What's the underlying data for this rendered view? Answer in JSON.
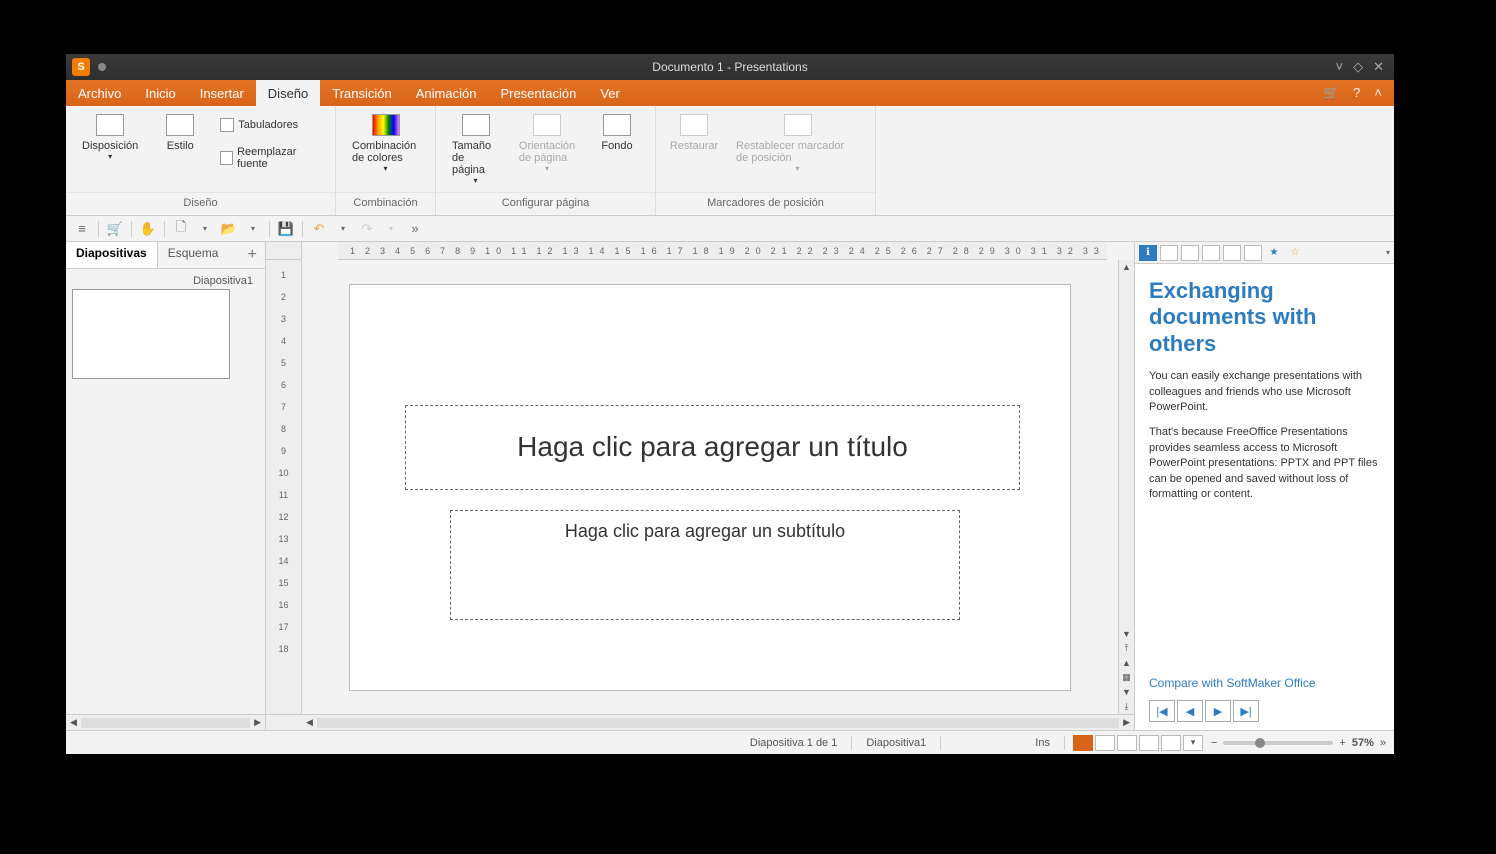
{
  "titlebar": {
    "title": "Documento 1 - Presentations",
    "app_letter": "S"
  },
  "menu": {
    "tabs": [
      "Archivo",
      "Inicio",
      "Insertar",
      "Diseño",
      "Transición",
      "Animación",
      "Presentación",
      "Ver"
    ],
    "active_index": 3
  },
  "ribbon": {
    "groups": [
      {
        "label": "Diseño",
        "items": [
          {
            "kind": "big",
            "label": "Disposición",
            "drop": true
          },
          {
            "kind": "big",
            "label": "Estilo"
          },
          {
            "kind": "small",
            "label": "Tabuladores"
          },
          {
            "kind": "small",
            "label": "Reemplazar fuente"
          }
        ]
      },
      {
        "label": "Combinación",
        "items": [
          {
            "kind": "big",
            "label": "Combinación de colores",
            "drop": true,
            "color": true
          }
        ]
      },
      {
        "label": "Configurar página",
        "items": [
          {
            "kind": "big",
            "label": "Tamaño de página",
            "drop": true
          },
          {
            "kind": "big",
            "label": "Orientación de página",
            "drop": true,
            "disabled": true
          },
          {
            "kind": "big",
            "label": "Fondo"
          }
        ]
      },
      {
        "label": "Marcadores de posición",
        "items": [
          {
            "kind": "big",
            "label": "Restaurar",
            "disabled": true
          },
          {
            "kind": "big",
            "label": "Restablecer marcador de posición",
            "drop": true,
            "disabled": true
          }
        ]
      }
    ]
  },
  "quickbar": {
    "hamburger": "≡",
    "cart": "🛒",
    "hand": "✋",
    "new": "🗋",
    "open": "📂",
    "save": "💾",
    "undo": "↶",
    "redo": "↷",
    "more": "»"
  },
  "sidebar": {
    "tabs": [
      "Diapositivas",
      "Esquema"
    ],
    "active": 0,
    "thumb_label": "Diapositiva1"
  },
  "ruler_h": [
    "1",
    "2",
    "3",
    "4",
    "5",
    "6",
    "7",
    "8",
    "9",
    "10",
    "11",
    "12",
    "13",
    "14",
    "15",
    "16",
    "17",
    "18",
    "19",
    "20",
    "21",
    "22",
    "23",
    "24",
    "25",
    "26",
    "27",
    "28",
    "29",
    "30",
    "31",
    "32",
    "33"
  ],
  "ruler_v": [
    "1",
    "2",
    "3",
    "4",
    "5",
    "6",
    "7",
    "8",
    "9",
    "10",
    "11",
    "12",
    "13",
    "14",
    "15",
    "16",
    "17",
    "18"
  ],
  "slide": {
    "title_placeholder": "Haga clic para agregar un título",
    "subtitle_placeholder": "Haga clic para agregar un subtítulo"
  },
  "rightpane": {
    "heading": "Exchanging documents with others",
    "p1": "You can easily exchange presentations with colleagues and friends who use Microsoft PowerPoint.",
    "p2": "That's because FreeOffice Presentations provides seamless access to Microsoft PowerPoint presentations: PPTX and PPT files can be opened and saved without loss of formatting or content.",
    "link": "Compare with SoftMaker Office",
    "info_glyph": "ℹ",
    "star1": "★",
    "star2": "☆",
    "nav": {
      "first": "|◀",
      "prev": "◀",
      "next": "▶",
      "last": "▶|"
    }
  },
  "status": {
    "slide_info": "Diapositiva 1 de 1",
    "master": "Diapositiva1",
    "ins": "Ins",
    "zoom": "57%",
    "minus": "−",
    "plus": "+",
    "more": "»"
  }
}
